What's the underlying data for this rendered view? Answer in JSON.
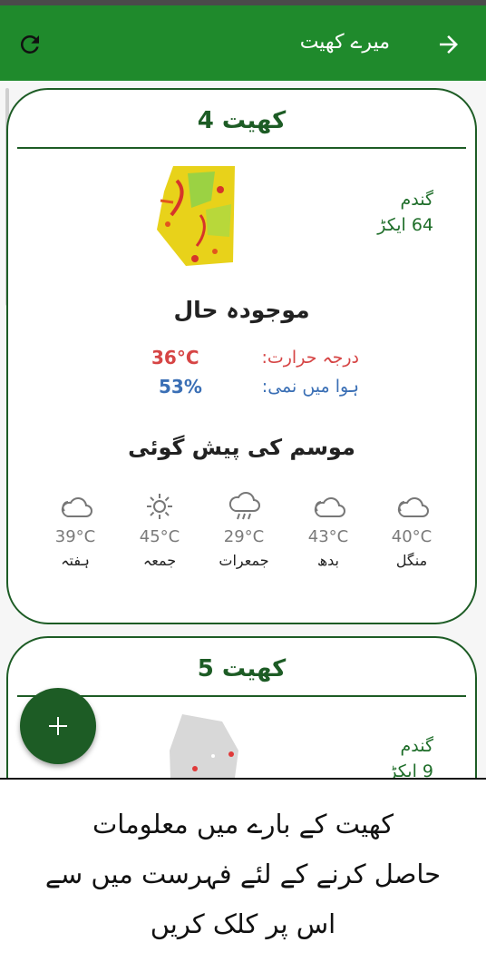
{
  "app_bar": {
    "title": "میرے کھیت",
    "refresh_icon": "refresh-icon",
    "back_icon": "arrow-right-icon",
    "color": "#1f8a2c"
  },
  "fields": [
    {
      "title": "کھیت 4",
      "crop": "گندم",
      "area": "64 ایکڑ",
      "current_title": "موجودہ حال",
      "temp_label": "درجہ حرارت:",
      "temp_value": "36°C",
      "humidity_label": "ہوا میں نمی:",
      "humidity_value": "53%",
      "forecast_title": "موسم کی پیش گوئی",
      "forecast": [
        {
          "day": "منگل",
          "temp": "40°C",
          "icon": "cloudy-icon"
        },
        {
          "day": "بدھ",
          "temp": "43°C",
          "icon": "cloudy-icon"
        },
        {
          "day": "جمعرات",
          "temp": "29°C",
          "icon": "rain-icon"
        },
        {
          "day": "جمعہ",
          "temp": "45°C",
          "icon": "sun-icon"
        },
        {
          "day": "ہفتہ",
          "temp": "39°C",
          "icon": "cloudy-icon"
        }
      ]
    },
    {
      "title": "کھیت 5",
      "crop": "گندم",
      "area": "9 ایکڑ"
    }
  ],
  "fab": {
    "icon": "plus-icon"
  },
  "hint": {
    "line1": "کھیت کے بارے میں معلومات",
    "line2": "حاصل کرنے کے لئے فہرست میں سے",
    "line3": "اس پر کلک کریں"
  },
  "colors": {
    "primary": "#1f8a2c",
    "card_border": "#1d5c25",
    "temp": "#d64545",
    "humidity": "#3a6fb5"
  }
}
